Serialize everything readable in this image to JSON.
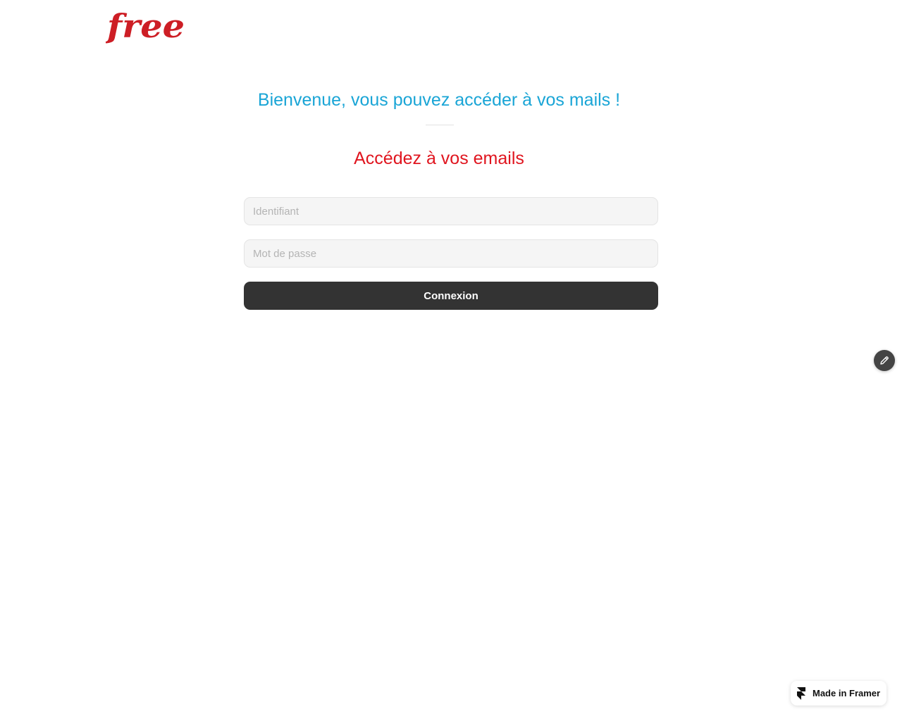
{
  "brand": {
    "logo_text": "free",
    "logo_color": "#cd1e25"
  },
  "header": {
    "welcome": "Bienvenue, vous pouvez accéder à vos mails !",
    "welcome_color": "#1aa5d6"
  },
  "form": {
    "title": "Accédez à vos emails",
    "title_color": "#e0151f",
    "username": {
      "value": "",
      "placeholder": "Identifiant"
    },
    "password": {
      "value": "",
      "placeholder": "Mot de passe"
    },
    "submit_label": "Connexion",
    "submit_color": "#333333"
  },
  "edit_button": {
    "icon": "pencil-icon"
  },
  "badge": {
    "icon": "framer-logo-icon",
    "label": "Made in Framer"
  }
}
